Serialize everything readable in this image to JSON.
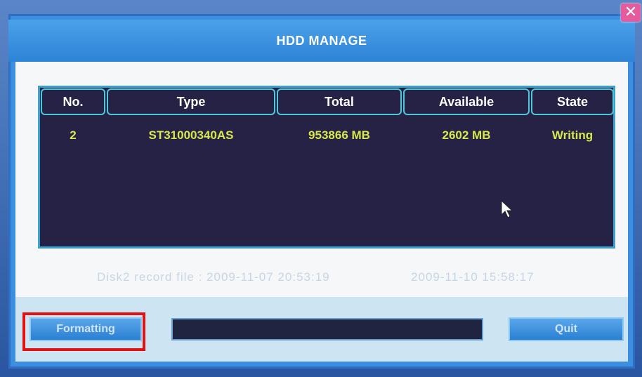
{
  "window": {
    "title": "HDD MANAGE",
    "close_glyph": "✕"
  },
  "table": {
    "columns": [
      "No.",
      "Type",
      "Total",
      "Available",
      "State"
    ],
    "rows": [
      {
        "no": "2",
        "type": "ST31000340AS",
        "total": "953866 MB",
        "available": "2602 MB",
        "state": "Writing"
      }
    ]
  },
  "record_info": {
    "label": "Disk2 record file : 2009-11-07 20:53:19",
    "end_time": "2009-11-10 15:58:17"
  },
  "buttons": {
    "format_label": "Formatting",
    "quit_label": "Quit"
  },
  "progress": {
    "value": 0
  },
  "colors": {
    "accent": "#3b8ee0",
    "table_bg": "#262245",
    "value_text": "#d7e84a",
    "highlight": "#e21212"
  }
}
